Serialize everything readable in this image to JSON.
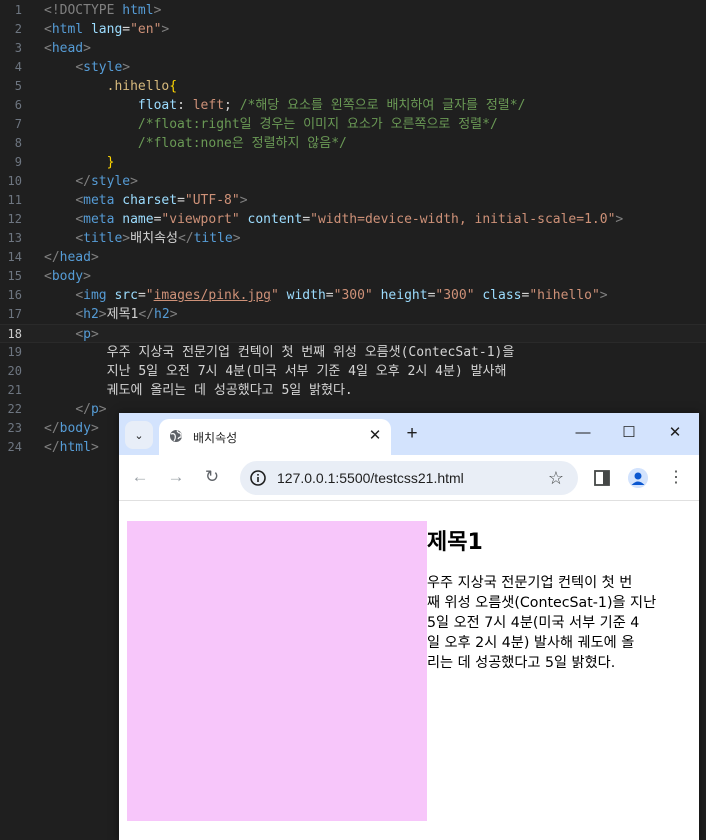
{
  "editor": {
    "line_numbers": [
      "1",
      "2",
      "3",
      "4",
      "5",
      "6",
      "7",
      "8",
      "9",
      "10",
      "11",
      "12",
      "13",
      "14",
      "15",
      "16",
      "17",
      "18",
      "19",
      "20",
      "21",
      "22",
      "23",
      "24"
    ],
    "current_line": "18",
    "lines": [
      [
        [
          "doc",
          "<!DOCTYPE "
        ],
        [
          "docw",
          "html"
        ],
        [
          "doc",
          ">"
        ]
      ],
      [
        [
          "angle",
          "<"
        ],
        [
          "tag",
          "html"
        ],
        [
          "text",
          " "
        ],
        [
          "attr",
          "lang"
        ],
        [
          "eq",
          "="
        ],
        [
          "val",
          "\"en\""
        ],
        [
          "angle",
          ">"
        ]
      ],
      [
        [
          "angle",
          "<"
        ],
        [
          "tag",
          "head"
        ],
        [
          "angle",
          ">"
        ]
      ],
      [
        [
          "text",
          "    "
        ],
        [
          "angle",
          "<"
        ],
        [
          "tag",
          "style"
        ],
        [
          "angle",
          ">"
        ]
      ],
      [
        [
          "text",
          "        "
        ],
        [
          "sel",
          ".hihello"
        ],
        [
          "brace",
          "{"
        ]
      ],
      [
        [
          "text",
          "            "
        ],
        [
          "prop",
          "float"
        ],
        [
          "text",
          ": "
        ],
        [
          "pval",
          "left"
        ],
        [
          "text",
          "; "
        ],
        [
          "cmt",
          "/*해당 요소를 왼쪽으로 배치하여 글자를 정렬*/"
        ]
      ],
      [
        [
          "text",
          "            "
        ],
        [
          "cmt",
          "/*float:right일 경우는 이미지 요소가 오른쪽으로 정렬*/"
        ]
      ],
      [
        [
          "text",
          "            "
        ],
        [
          "cmt",
          "/*float:none은 정렬하지 않음*/"
        ]
      ],
      [
        [
          "text",
          "        "
        ],
        [
          "brace",
          "}"
        ]
      ],
      [
        [
          "text",
          "    "
        ],
        [
          "angle",
          "</"
        ],
        [
          "tag",
          "style"
        ],
        [
          "angle",
          ">"
        ]
      ],
      [
        [
          "text",
          "    "
        ],
        [
          "angle",
          "<"
        ],
        [
          "tag",
          "meta"
        ],
        [
          "text",
          " "
        ],
        [
          "attr",
          "charset"
        ],
        [
          "eq",
          "="
        ],
        [
          "val",
          "\"UTF-8\""
        ],
        [
          "angle",
          ">"
        ]
      ],
      [
        [
          "text",
          "    "
        ],
        [
          "angle",
          "<"
        ],
        [
          "tag",
          "meta"
        ],
        [
          "text",
          " "
        ],
        [
          "attr",
          "name"
        ],
        [
          "eq",
          "="
        ],
        [
          "val",
          "\"viewport\""
        ],
        [
          "text",
          " "
        ],
        [
          "attr",
          "content"
        ],
        [
          "eq",
          "="
        ],
        [
          "val",
          "\"width=device-width, initial-scale=1.0\""
        ],
        [
          "angle",
          ">"
        ]
      ],
      [
        [
          "text",
          "    "
        ],
        [
          "angle",
          "<"
        ],
        [
          "tag",
          "title"
        ],
        [
          "angle",
          ">"
        ],
        [
          "text",
          "배치속성"
        ],
        [
          "angle",
          "</"
        ],
        [
          "tag",
          "title"
        ],
        [
          "angle",
          ">"
        ]
      ],
      [
        [
          "angle",
          "</"
        ],
        [
          "tag",
          "head"
        ],
        [
          "angle",
          ">"
        ]
      ],
      [
        [
          "angle",
          "<"
        ],
        [
          "tag",
          "body"
        ],
        [
          "angle",
          ">"
        ]
      ],
      [
        [
          "text",
          "    "
        ],
        [
          "angle",
          "<"
        ],
        [
          "tag",
          "img"
        ],
        [
          "text",
          " "
        ],
        [
          "attr",
          "src"
        ],
        [
          "eq",
          "="
        ],
        [
          "val",
          "\""
        ],
        [
          "valu",
          "images/pink.jpg"
        ],
        [
          "val",
          "\""
        ],
        [
          "text",
          " "
        ],
        [
          "attr",
          "width"
        ],
        [
          "eq",
          "="
        ],
        [
          "val",
          "\"300\""
        ],
        [
          "text",
          " "
        ],
        [
          "attr",
          "height"
        ],
        [
          "eq",
          "="
        ],
        [
          "val",
          "\"300\""
        ],
        [
          "text",
          " "
        ],
        [
          "attr",
          "class"
        ],
        [
          "eq",
          "="
        ],
        [
          "val",
          "\"hihello\""
        ],
        [
          "angle",
          ">"
        ]
      ],
      [
        [
          "text",
          "    "
        ],
        [
          "angle",
          "<"
        ],
        [
          "tag",
          "h2"
        ],
        [
          "angle",
          ">"
        ],
        [
          "text",
          "제목1"
        ],
        [
          "angle",
          "</"
        ],
        [
          "tag",
          "h2"
        ],
        [
          "angle",
          ">"
        ]
      ],
      [
        [
          "text",
          "    "
        ],
        [
          "angle",
          "<"
        ],
        [
          "tag",
          "p"
        ],
        [
          "angle",
          ">"
        ]
      ],
      [
        [
          "text",
          "        우주 지상국 전문기업 컨텍이 첫 번째 위성 오름샛(ContecSat-1)을"
        ]
      ],
      [
        [
          "text",
          "        지난 5일 오전 7시 4분(미국 서부 기준 4일 오후 2시 4분) 발사해"
        ]
      ],
      [
        [
          "text",
          "        궤도에 올리는 데 성공했다고 5일 밝혔다."
        ]
      ],
      [
        [
          "text",
          "    "
        ],
        [
          "angle",
          "</"
        ],
        [
          "tag",
          "p"
        ],
        [
          "angle",
          ">"
        ]
      ],
      [
        [
          "angle",
          "</"
        ],
        [
          "tag",
          "body"
        ],
        [
          "angle",
          ">"
        ]
      ],
      [
        [
          "angle",
          "</"
        ],
        [
          "tag",
          "html"
        ],
        [
          "angle",
          ">"
        ]
      ]
    ]
  },
  "browser": {
    "tab_title": "배치속성",
    "tab_close_glyph": "✕",
    "new_tab_glyph": "+",
    "tab_search_glyph": "⌄",
    "minimize_glyph": "—",
    "maximize_glyph": "☐",
    "close_glyph": "✕",
    "back_glyph": "←",
    "forward_glyph": "→",
    "reload_glyph": "↻",
    "star_glyph": "☆",
    "menu_glyph": "⋮",
    "url": "127.0.0.1:5500/testcss21.html",
    "accent_color": "#d3e3fd",
    "image_color": "#f7c6fa"
  },
  "page": {
    "heading": "제목1",
    "paragraph_lines": [
      "우주 지상국 전문기업 컨텍이 첫 번",
      "째 위성 오름샛(ContecSat-1)을 지난",
      "5일 오전 7시 4분(미국 서부 기준 4",
      "일 오후 2시 4분) 발사해 궤도에 올",
      "리는 데 성공했다고 5일 밝혔다."
    ]
  }
}
